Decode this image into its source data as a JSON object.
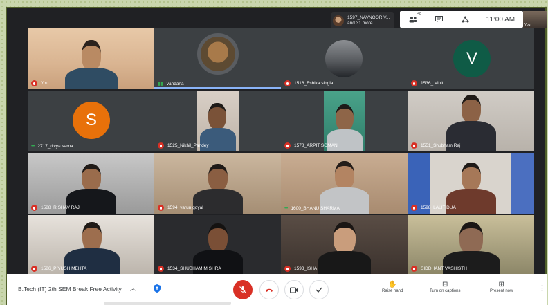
{
  "presenter": {
    "name": "1597_NAVNOOR V...",
    "more": "and 31 more"
  },
  "top_toolbar": {
    "participants_count": "48",
    "time": "11:00 AM",
    "self_label": "You"
  },
  "tiles": [
    {
      "name": "You",
      "status": "muted"
    },
    {
      "name": "vandana",
      "status": "speaking"
    },
    {
      "name": "1516_Eshika singla",
      "status": "muted"
    },
    {
      "name": "1536_ Vinit",
      "status": "muted",
      "avatar_letter": "V"
    },
    {
      "name": "2717_divya sarna",
      "status": "active",
      "avatar_letter": "S"
    },
    {
      "name": "1525_Nikhil_Pandey",
      "status": "muted"
    },
    {
      "name": "1578_ARPIT SOMANI",
      "status": "muted"
    },
    {
      "name": "1551_Shubham Raj",
      "status": "muted"
    },
    {
      "name": "1588_RISHAV RAJ",
      "status": "muted"
    },
    {
      "name": "1594_varun goyal",
      "status": "muted"
    },
    {
      "name": "1600_BHANU SHARMA",
      "status": "active"
    },
    {
      "name": "1598_LALIT DUA",
      "status": "muted"
    },
    {
      "name": "1586_PIYUSH MEHTA",
      "status": "muted"
    },
    {
      "name": "1534_SHUBHAM MISHRA",
      "status": "muted"
    },
    {
      "name": "1593_ISHA",
      "status": "muted"
    },
    {
      "name": "SIDDHANT VASHISTH",
      "status": "muted"
    }
  ],
  "bottom_bar": {
    "meeting_title": "B.Tech (IT) 2th SEM Break Free Activity",
    "raise_hand": "Raise hand",
    "captions": "Turn on captions",
    "present": "Present now"
  },
  "colors": {
    "avatar_v": "#0f5b46",
    "avatar_s": "#e8710a",
    "mic_off": "#d93025",
    "end_call": "#d93025"
  }
}
